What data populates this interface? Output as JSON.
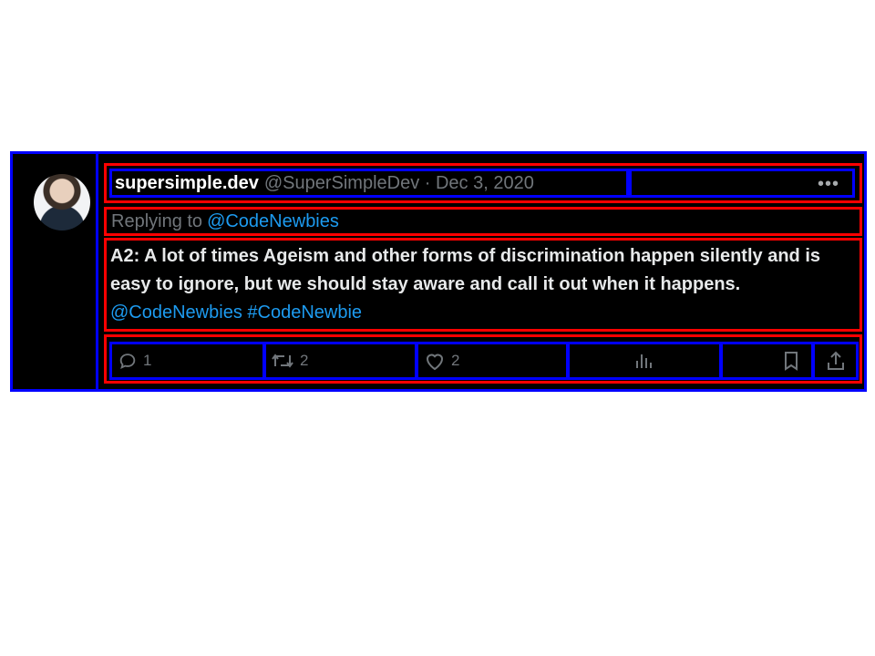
{
  "tweet": {
    "display_name": "supersimple.dev",
    "handle_date": "@SuperSimpleDev · Dec 3, 2020",
    "more_icon": "more-horizontal-icon",
    "replying_label": "Replying to",
    "replying_user": "@CodeNewbies",
    "text_main": "A2: A lot of times Ageism and other forms of discrimination happen silently and is easy to ignore, but we should stay aware and call it out when it happens.",
    "text_mention": "@CodeNewbies",
    "text_hashtag": "#CodeNewbie"
  },
  "actions": {
    "reply": {
      "icon": "reply-icon",
      "count": "1"
    },
    "retweet": {
      "icon": "retweet-icon",
      "count": "2"
    },
    "like": {
      "icon": "heart-icon",
      "count": "2"
    },
    "views": {
      "icon": "views-icon"
    },
    "bookmark": {
      "icon": "bookmark-icon"
    },
    "share": {
      "icon": "share-icon"
    }
  },
  "colors": {
    "background": "#000000",
    "text": "#e7e9ea",
    "muted": "#71767b",
    "link": "#1d9bf0",
    "outline_outer": "#0000ff",
    "outline_inner": "#ff0000"
  }
}
